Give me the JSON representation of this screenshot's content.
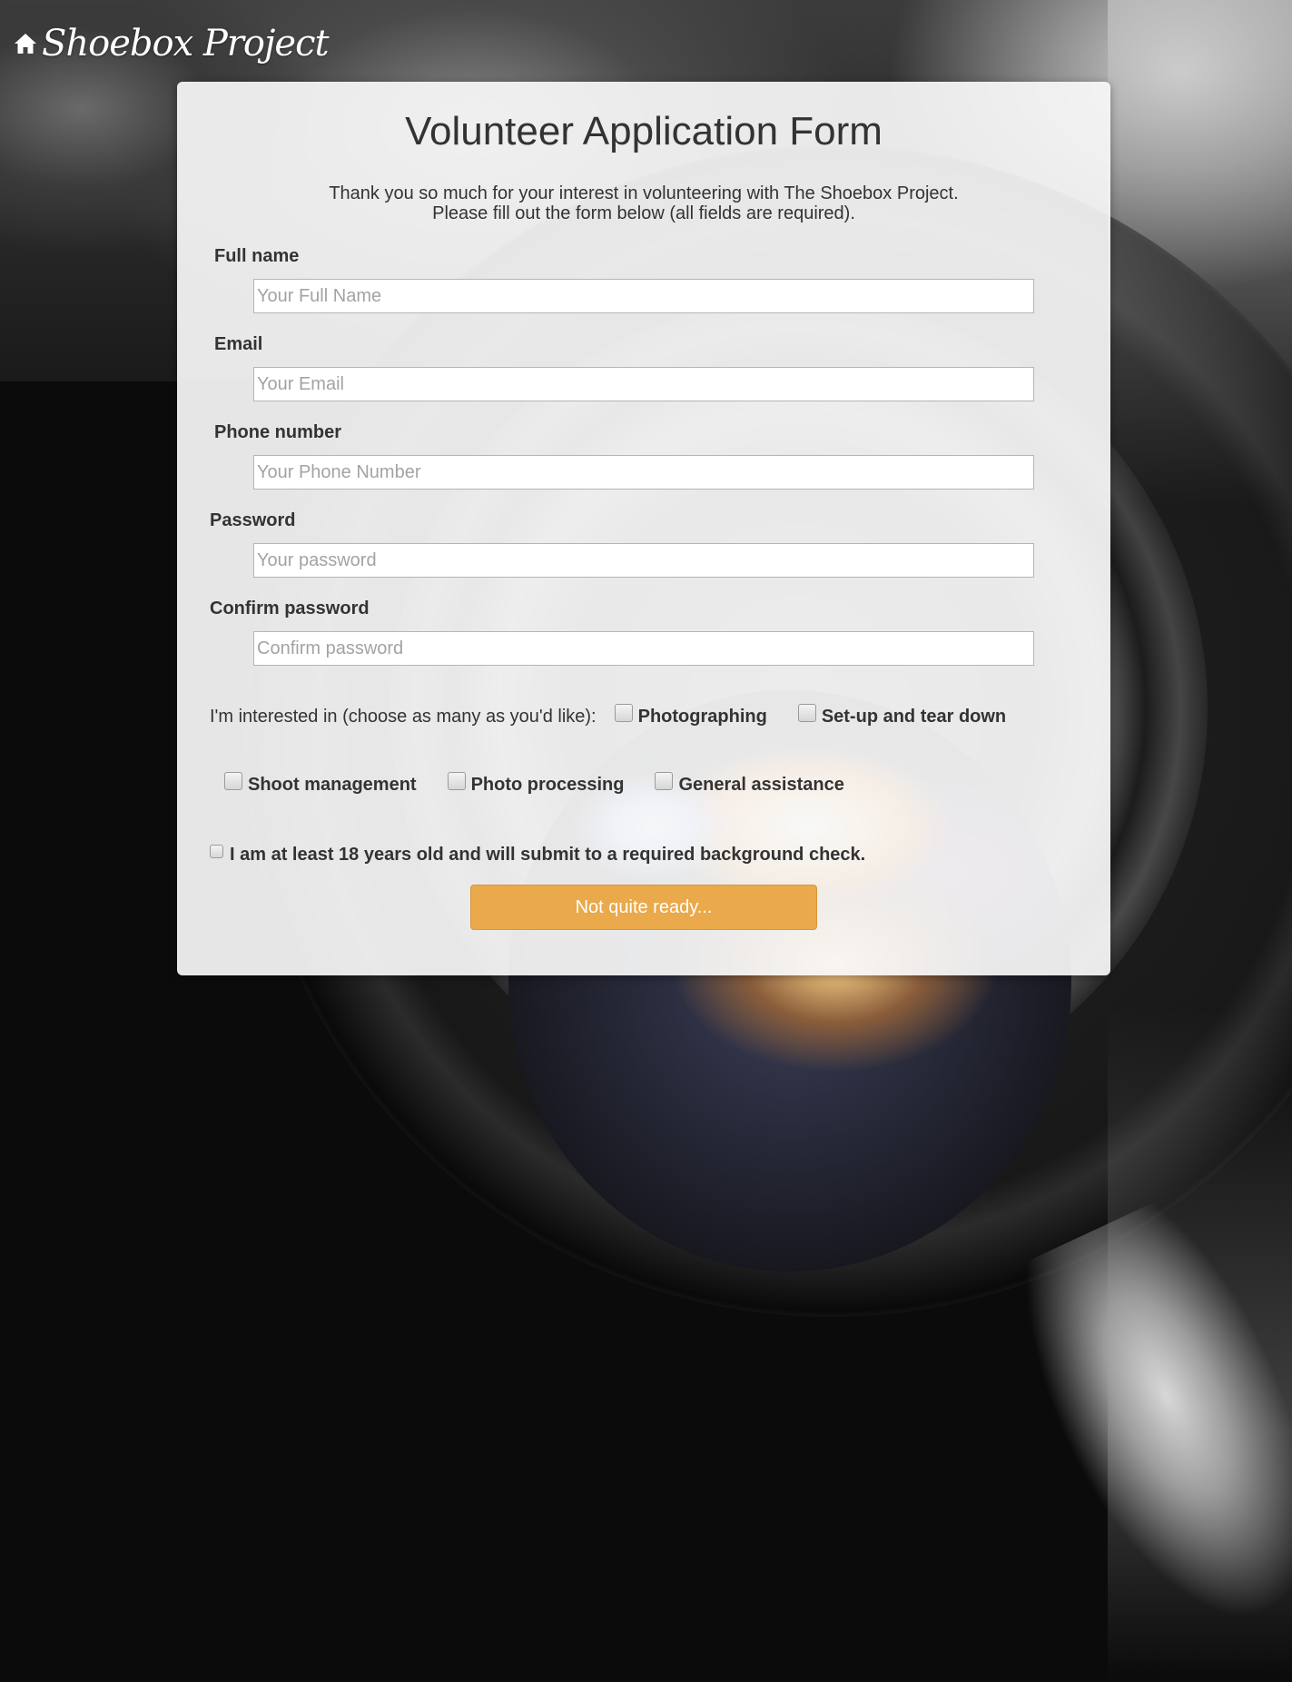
{
  "header": {
    "logo_text": "Shoebox Project",
    "home_icon": "home-icon"
  },
  "form": {
    "title": "Volunteer Application Form",
    "intro_line1": "Thank you so much for your interest in volunteering with The Shoebox Project.",
    "intro_line2": "Please fill out the form below (all fields are required).",
    "fields": [
      {
        "label": "Full name",
        "placeholder": "Your Full Name",
        "value": ""
      },
      {
        "label": "Email",
        "placeholder": "Your Email",
        "value": ""
      },
      {
        "label": "Phone number",
        "placeholder": "Your Phone Number",
        "value": ""
      },
      {
        "label": "Password",
        "placeholder": "Your password",
        "value": ""
      },
      {
        "label": "Confirm password",
        "placeholder": "Confirm password",
        "value": ""
      }
    ],
    "interests": {
      "prompt": "I'm interested in (choose as many as you'd like):",
      "options": [
        {
          "label": "Photographing",
          "checked": false
        },
        {
          "label": "Set-up and tear down",
          "checked": false
        },
        {
          "label": "Shoot management",
          "checked": false
        },
        {
          "label": "Photo processing",
          "checked": false
        },
        {
          "label": "General assistance",
          "checked": false
        }
      ]
    },
    "age_consent": {
      "label": "I am at least 18 years old and will submit to a required background check.",
      "checked": false
    },
    "submit_label": "Not quite ready...",
    "submit_color": "#eaa94a"
  }
}
